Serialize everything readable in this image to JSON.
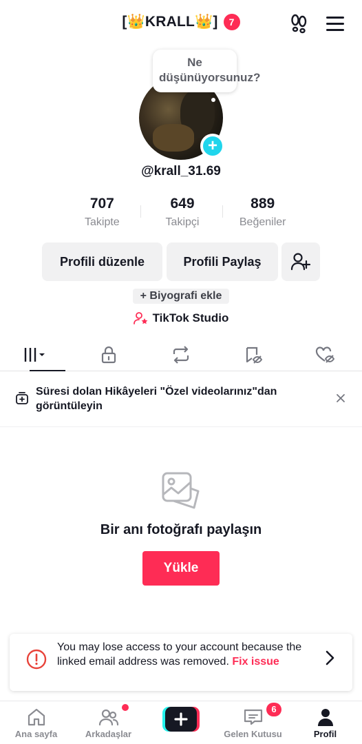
{
  "header": {
    "title": "[👑KRALL👑]",
    "notification_count": "7"
  },
  "profile": {
    "bubble_text": "Ne düşünüyorsunuz?",
    "handle": "@krall_31.69"
  },
  "stats": [
    {
      "value": "707",
      "label": "Takipte"
    },
    {
      "value": "649",
      "label": "Takipçi"
    },
    {
      "value": "889",
      "label": "Beğeniler"
    }
  ],
  "actions": {
    "edit_label": "Profili düzenle",
    "share_label": "Profili Paylaş"
  },
  "bio_chip": "+ Biyografi ekle",
  "studio_label": "TikTok Studio",
  "notice": {
    "text": "Süresi dolan Hikâyeleri \"Özel videolarınız\"dan görüntüleyin"
  },
  "empty": {
    "title": "Bir anı fotoğrafı paylaşın",
    "upload_label": "Yükle"
  },
  "alert": {
    "text": "You may lose access to your account because the linked email address was removed.",
    "fix_label": "Fix issue"
  },
  "nav": {
    "home": "Ana sayfa",
    "friends": "Arkadaşlar",
    "inbox": "Gelen Kutusu",
    "inbox_count": "6",
    "profile": "Profil"
  },
  "colors": {
    "accent": "#fe2c55",
    "cyan": "#20d5ec",
    "text": "#161823",
    "muted": "#8a8b91",
    "button_bg": "#f1f1f2"
  }
}
